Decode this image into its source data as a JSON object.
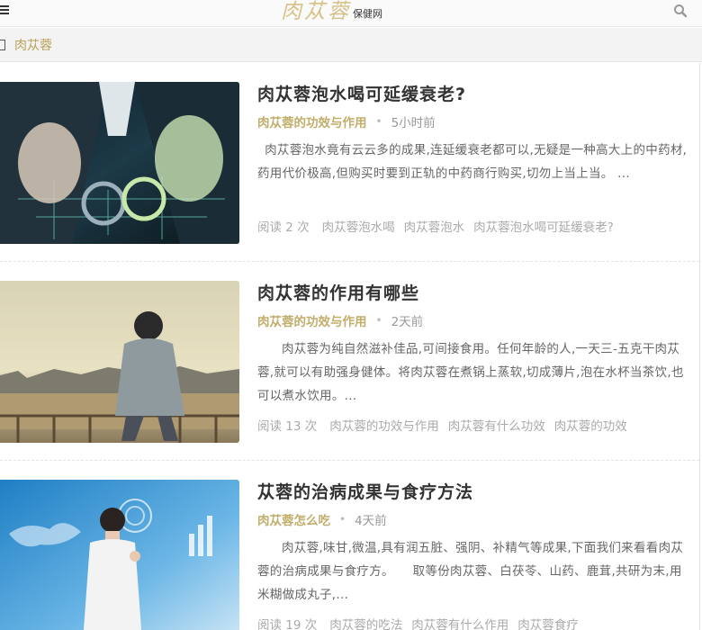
{
  "header": {
    "logo_main": "肉苁蓉",
    "logo_sub": "保健网"
  },
  "breadcrumb": {
    "current": "肉苁蓉"
  },
  "articles": [
    {
      "title": "肉苁蓉泡水喝可延缓衰老?",
      "category": "肉苁蓉的功效与作用",
      "time": "5小时前",
      "excerpt": "肉苁蓉泡水竟有云云多的成果,连延缓衰老都可以,无疑是一种高大上的中药材,药用代价极高,但购买时要到正轨的中药商行购买,切勿上当上当。 ...",
      "reads": "阅读 2 次",
      "tags": [
        "肉苁蓉泡水喝",
        "肉苁蓉泡水",
        "肉苁蓉泡水喝可延缓衰老?"
      ]
    },
    {
      "title": "肉苁蓉的作用有哪些",
      "category": "肉苁蓉的功效与作用",
      "time": "2天前",
      "excerpt": "肉苁蓉为纯自然滋补佳品,可间接食用。任何年龄的人,一天三-五克干肉苁蓉,就可以有助强身健体。将肉苁蓉在煮锅上蒸软,切成薄片,泡在水杯当茶饮,也可以煮水饮用。...",
      "reads": "阅读 13 次",
      "tags": [
        "肉苁蓉的功效与作用",
        "肉苁蓉有什么功效",
        "肉苁蓉的功效"
      ]
    },
    {
      "title": "苁蓉的治病成果与食疗方法",
      "category": "肉苁蓉怎么吃",
      "time": "4天前",
      "excerpt": "肉苁蓉,味甘,微温,具有润五脏、强阴、补精气等成果,下面我们来看看肉苁蓉的治病成果与食疗方。　　取等份肉苁蓉、白茯苓、山药、鹿茸,共研为末,用米糊做成丸子,...",
      "reads": "阅读 19 次",
      "tags": [
        "肉苁蓉的吃法",
        "肉苁蓉有什么作用",
        "肉苁蓉食疗"
      ]
    }
  ]
}
